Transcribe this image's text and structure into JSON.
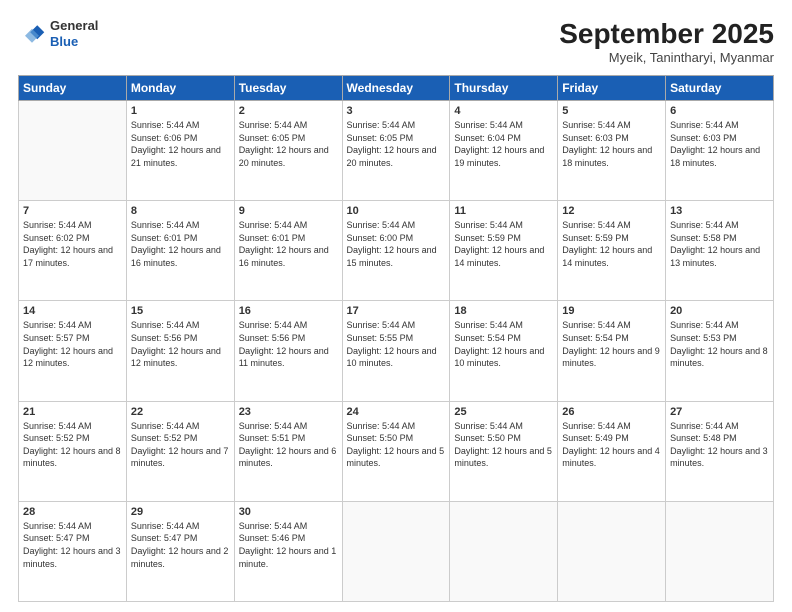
{
  "header": {
    "logo": {
      "general": "General",
      "blue": "Blue"
    },
    "title": "September 2025",
    "location": "Myeik, Tanintharyi, Myanmar"
  },
  "weekdays": [
    "Sunday",
    "Monday",
    "Tuesday",
    "Wednesday",
    "Thursday",
    "Friday",
    "Saturday"
  ],
  "weeks": [
    [
      {
        "day": "",
        "empty": true
      },
      {
        "day": "1",
        "sunrise": "5:44 AM",
        "sunset": "6:06 PM",
        "daylight": "12 hours and 21 minutes."
      },
      {
        "day": "2",
        "sunrise": "5:44 AM",
        "sunset": "6:05 PM",
        "daylight": "12 hours and 20 minutes."
      },
      {
        "day": "3",
        "sunrise": "5:44 AM",
        "sunset": "6:05 PM",
        "daylight": "12 hours and 20 minutes."
      },
      {
        "day": "4",
        "sunrise": "5:44 AM",
        "sunset": "6:04 PM",
        "daylight": "12 hours and 19 minutes."
      },
      {
        "day": "5",
        "sunrise": "5:44 AM",
        "sunset": "6:03 PM",
        "daylight": "12 hours and 18 minutes."
      },
      {
        "day": "6",
        "sunrise": "5:44 AM",
        "sunset": "6:03 PM",
        "daylight": "12 hours and 18 minutes."
      }
    ],
    [
      {
        "day": "7",
        "sunrise": "5:44 AM",
        "sunset": "6:02 PM",
        "daylight": "12 hours and 17 minutes."
      },
      {
        "day": "8",
        "sunrise": "5:44 AM",
        "sunset": "6:01 PM",
        "daylight": "12 hours and 16 minutes."
      },
      {
        "day": "9",
        "sunrise": "5:44 AM",
        "sunset": "6:01 PM",
        "daylight": "12 hours and 16 minutes."
      },
      {
        "day": "10",
        "sunrise": "5:44 AM",
        "sunset": "6:00 PM",
        "daylight": "12 hours and 15 minutes."
      },
      {
        "day": "11",
        "sunrise": "5:44 AM",
        "sunset": "5:59 PM",
        "daylight": "12 hours and 14 minutes."
      },
      {
        "day": "12",
        "sunrise": "5:44 AM",
        "sunset": "5:59 PM",
        "daylight": "12 hours and 14 minutes."
      },
      {
        "day": "13",
        "sunrise": "5:44 AM",
        "sunset": "5:58 PM",
        "daylight": "12 hours and 13 minutes."
      }
    ],
    [
      {
        "day": "14",
        "sunrise": "5:44 AM",
        "sunset": "5:57 PM",
        "daylight": "12 hours and 12 minutes."
      },
      {
        "day": "15",
        "sunrise": "5:44 AM",
        "sunset": "5:56 PM",
        "daylight": "12 hours and 12 minutes."
      },
      {
        "day": "16",
        "sunrise": "5:44 AM",
        "sunset": "5:56 PM",
        "daylight": "12 hours and 11 minutes."
      },
      {
        "day": "17",
        "sunrise": "5:44 AM",
        "sunset": "5:55 PM",
        "daylight": "12 hours and 10 minutes."
      },
      {
        "day": "18",
        "sunrise": "5:44 AM",
        "sunset": "5:54 PM",
        "daylight": "12 hours and 10 minutes."
      },
      {
        "day": "19",
        "sunrise": "5:44 AM",
        "sunset": "5:54 PM",
        "daylight": "12 hours and 9 minutes."
      },
      {
        "day": "20",
        "sunrise": "5:44 AM",
        "sunset": "5:53 PM",
        "daylight": "12 hours and 8 minutes."
      }
    ],
    [
      {
        "day": "21",
        "sunrise": "5:44 AM",
        "sunset": "5:52 PM",
        "daylight": "12 hours and 8 minutes."
      },
      {
        "day": "22",
        "sunrise": "5:44 AM",
        "sunset": "5:52 PM",
        "daylight": "12 hours and 7 minutes."
      },
      {
        "day": "23",
        "sunrise": "5:44 AM",
        "sunset": "5:51 PM",
        "daylight": "12 hours and 6 minutes."
      },
      {
        "day": "24",
        "sunrise": "5:44 AM",
        "sunset": "5:50 PM",
        "daylight": "12 hours and 5 minutes."
      },
      {
        "day": "25",
        "sunrise": "5:44 AM",
        "sunset": "5:50 PM",
        "daylight": "12 hours and 5 minutes."
      },
      {
        "day": "26",
        "sunrise": "5:44 AM",
        "sunset": "5:49 PM",
        "daylight": "12 hours and 4 minutes."
      },
      {
        "day": "27",
        "sunrise": "5:44 AM",
        "sunset": "5:48 PM",
        "daylight": "12 hours and 3 minutes."
      }
    ],
    [
      {
        "day": "28",
        "sunrise": "5:44 AM",
        "sunset": "5:47 PM",
        "daylight": "12 hours and 3 minutes."
      },
      {
        "day": "29",
        "sunrise": "5:44 AM",
        "sunset": "5:47 PM",
        "daylight": "12 hours and 2 minutes."
      },
      {
        "day": "30",
        "sunrise": "5:44 AM",
        "sunset": "5:46 PM",
        "daylight": "12 hours and 1 minute."
      },
      {
        "day": "",
        "empty": true
      },
      {
        "day": "",
        "empty": true
      },
      {
        "day": "",
        "empty": true
      },
      {
        "day": "",
        "empty": true
      }
    ]
  ]
}
